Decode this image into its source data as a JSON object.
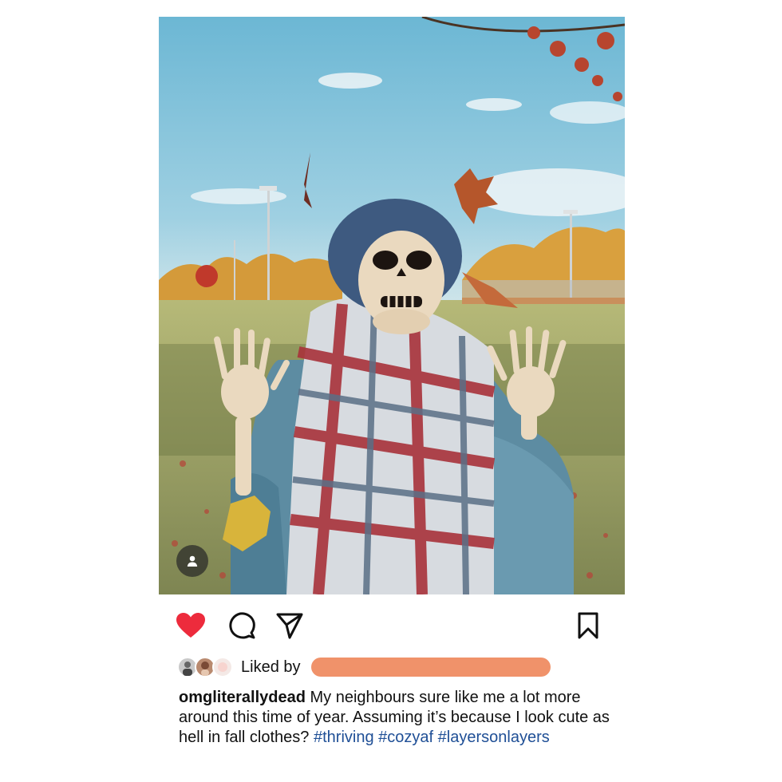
{
  "post": {
    "username": "omgliterallydead",
    "liked_by_label": "Liked by",
    "caption_text": "My neighbours sure like me a lot more around this time of year. Assuming it’s because I look cute as hell in fall clothes?",
    "hashtags": [
      "#thriving",
      "#cozyaf",
      "#layersonlayers"
    ]
  },
  "icons": {
    "like": "heart-icon",
    "comment": "comment-icon",
    "share": "send-icon",
    "save": "bookmark-icon",
    "tag": "person-icon"
  },
  "colors": {
    "like_red": "#ed2b3c",
    "hashtag_blue": "#1f4f96",
    "redaction": "#f0926a"
  }
}
